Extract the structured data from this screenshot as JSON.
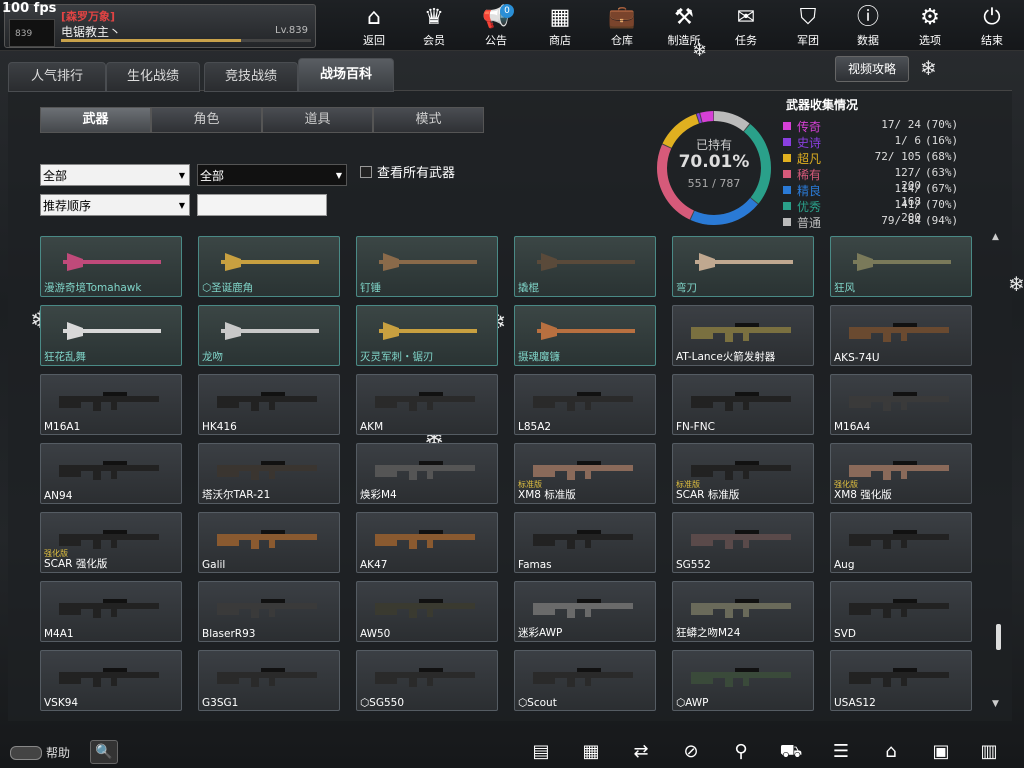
{
  "fps": "100 fps",
  "profile": {
    "guild": "[森罗万象]",
    "name": "电锯教主丶",
    "level": "Lv.839",
    "avatar_badge": "839",
    "xp_progress": 0.72
  },
  "nav": [
    {
      "label": "返回",
      "icon": "home-icon",
      "glyph": "⌂"
    },
    {
      "label": "会员",
      "icon": "crown-icon",
      "glyph": "♛"
    },
    {
      "label": "公告",
      "icon": "megaphone-icon",
      "glyph": "📢",
      "badge": "0"
    },
    {
      "label": "商店",
      "icon": "shop-icon",
      "glyph": "▦"
    },
    {
      "label": "仓库",
      "icon": "briefcase-icon",
      "glyph": "💼"
    },
    {
      "label": "制造所",
      "icon": "craft-icon",
      "glyph": "⚒"
    },
    {
      "label": "任务",
      "icon": "mission-icon",
      "glyph": "✉"
    },
    {
      "label": "军团",
      "icon": "shield-icon",
      "glyph": "⛉"
    },
    {
      "label": "数据",
      "icon": "info-icon",
      "glyph": "ⓘ"
    },
    {
      "label": "选项",
      "icon": "gear-icon",
      "glyph": "⚙"
    },
    {
      "label": "结束",
      "icon": "power-icon",
      "glyph": "⏻"
    }
  ],
  "tabs": [
    "人气排行",
    "生化战绩",
    "竞技战绩",
    "战场百科"
  ],
  "video_button": "视频攻略",
  "subtabs": [
    "武器",
    "角色",
    "道具",
    "模式"
  ],
  "filters": {
    "filter1": "全部",
    "filter2": "全部",
    "sort": "推荐顺序",
    "search_value": "",
    "show_all_label": "查看所有武器"
  },
  "collection": {
    "owned_title": "已持有",
    "owned_pct": "70.01%",
    "owned_count": "551 / 787",
    "title": "武器收集情况",
    "rarities": [
      {
        "name": "传奇",
        "count": "17/  24",
        "pct": "(70%)",
        "color": "#d640d6"
      },
      {
        "name": "史诗",
        "count": "1/   6",
        "pct": "(16%)",
        "color": "#8a3fe0"
      },
      {
        "name": "超凡",
        "count": "72/ 105",
        "pct": "(68%)",
        "color": "#e0b020"
      },
      {
        "name": "稀有",
        "count": "127/ 200",
        "pct": "(63%)",
        "color": "#d65a7a"
      },
      {
        "name": "精良",
        "count": "114/ 168",
        "pct": "(67%)",
        "color": "#2a7ad6"
      },
      {
        "name": "优秀",
        "count": "141/ 200",
        "pct": "(70%)",
        "color": "#2aa08a"
      },
      {
        "name": "普通",
        "count": "79/  84",
        "pct": "(94%)",
        "color": "#bbbbbb"
      }
    ]
  },
  "weapons": [
    {
      "name": "漫游奇境Tomahawk",
      "kind": "melee",
      "color": "#c04a7a"
    },
    {
      "name": "圣诞鹿角",
      "kind": "melee",
      "color": "#c8a040",
      "prefix": "⬡"
    },
    {
      "name": "钉锤",
      "kind": "melee",
      "color": "#8a6a4a"
    },
    {
      "name": "撬棍",
      "kind": "melee",
      "color": "#5a4a3a"
    },
    {
      "name": "弯刀",
      "kind": "melee",
      "color": "#c0a890"
    },
    {
      "name": "狂风",
      "kind": "melee",
      "color": "#7a7a5a"
    },
    {
      "name": "狂花乱舞",
      "kind": "melee",
      "color": "#d8d8d8"
    },
    {
      "name": "龙吻",
      "kind": "melee",
      "color": "#c8c8c8"
    },
    {
      "name": "灭灵军刺・锯刃",
      "kind": "melee",
      "color": "#c8a040"
    },
    {
      "name": "摄魂魔镰",
      "kind": "melee",
      "color": "#b87040"
    },
    {
      "name": "AT-Lance火箭发射器",
      "kind": "gun",
      "color": "#7a7040"
    },
    {
      "name": "AKS-74U",
      "kind": "gun",
      "color": "#6a4a30"
    },
    {
      "name": "M16A1",
      "kind": "gun",
      "color": "#222"
    },
    {
      "name": "HK416",
      "kind": "gun",
      "color": "#222"
    },
    {
      "name": "AKM",
      "kind": "gun",
      "color": "#2a2a2a"
    },
    {
      "name": "L85A2",
      "kind": "gun",
      "color": "#2a2a2a"
    },
    {
      "name": "FN-FNC",
      "kind": "gun",
      "color": "#222"
    },
    {
      "name": "M16A4",
      "kind": "gun",
      "color": "#3a3a3a"
    },
    {
      "name": "AN94",
      "kind": "gun",
      "color": "#222"
    },
    {
      "name": "塔沃尔TAR-21",
      "kind": "gun",
      "color": "#3a3530"
    },
    {
      "name": "焕彩M4",
      "kind": "gun",
      "color": "#555"
    },
    {
      "name": "XM8 标准版",
      "kind": "gun",
      "color": "#8a6a5a",
      "tag": "标准版"
    },
    {
      "name": "SCAR 标准版",
      "kind": "gun",
      "color": "#222",
      "tag": "标准版"
    },
    {
      "name": "XM8 强化版",
      "kind": "gun",
      "color": "#8a6a5a",
      "tag": "强化版"
    },
    {
      "name": "SCAR 强化版",
      "kind": "gun",
      "color": "#222",
      "tag": "强化版"
    },
    {
      "name": "Galil",
      "kind": "gun",
      "color": "#8a5a30"
    },
    {
      "name": "AK47",
      "kind": "gun",
      "color": "#8a5a30"
    },
    {
      "name": "Famas",
      "kind": "gun",
      "color": "#222"
    },
    {
      "name": "SG552",
      "kind": "gun",
      "color": "#5a4a4a"
    },
    {
      "name": "Aug",
      "kind": "gun",
      "color": "#222"
    },
    {
      "name": "M4A1",
      "kind": "gun",
      "color": "#222"
    },
    {
      "name": "BlaserR93",
      "kind": "gun",
      "color": "#3a3a3a"
    },
    {
      "name": "AW50",
      "kind": "gun",
      "color": "#3a3a30"
    },
    {
      "name": "迷彩AWP",
      "kind": "gun",
      "color": "#6a6a6a"
    },
    {
      "name": "狂蟒之吻M24",
      "kind": "gun",
      "color": "#6a6a5a"
    },
    {
      "name": "SVD",
      "kind": "gun",
      "color": "#222"
    },
    {
      "name": "VSK94",
      "kind": "gun",
      "color": "#222"
    },
    {
      "name": "G3SG1",
      "kind": "gun",
      "color": "#2a2a2a"
    },
    {
      "name": "SG550",
      "kind": "gun",
      "color": "#2a2a2a",
      "prefix": "⬡"
    },
    {
      "name": "Scout",
      "kind": "gun",
      "color": "#2a2a2a",
      "prefix": "⬡"
    },
    {
      "name": "AWP",
      "kind": "gun",
      "color": "#3a4a3a",
      "prefix": "⬡"
    },
    {
      "name": "USAS12",
      "kind": "gun",
      "color": "#222"
    }
  ],
  "bottom": {
    "help_label": "帮助",
    "icons": [
      "ticket-icon",
      "list-icon",
      "swap-icon",
      "compass-icon",
      "runner-icon",
      "cart-icon",
      "checklist-icon",
      "house-icon",
      "calendar-icon",
      "film-icon"
    ],
    "glyphs": [
      "▤",
      "▦",
      "⇄",
      "⊘",
      "⚲",
      "⛟",
      "☰",
      "⌂",
      "▣",
      "▥"
    ]
  }
}
